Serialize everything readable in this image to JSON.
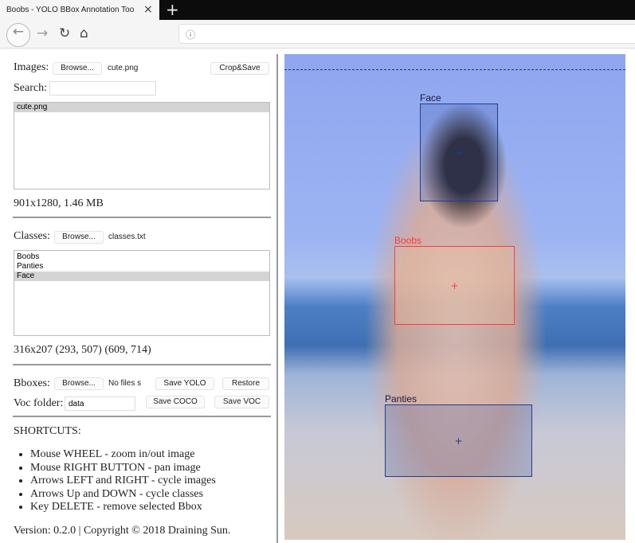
{
  "browser": {
    "tab_title": "Boobs - YOLO BBox Annotation Too",
    "close_icon": "×",
    "new_tab_icon": "+",
    "url": "ⓘ"
  },
  "images": {
    "label": "Images:",
    "browse": "Browse...",
    "file": "cute.png",
    "crop_save": "Crop&Save",
    "search_label": "Search:",
    "search_value": "",
    "list": [
      "cute.png"
    ],
    "info": "901x1280, 1.46 MB"
  },
  "classes": {
    "label": "Classes:",
    "browse": "Browse...",
    "file": "classes.txt",
    "list": [
      "Boobs",
      "Panties",
      "Face"
    ],
    "selected": "Face",
    "info": "316x207 (293, 507) (609, 714)"
  },
  "bboxes": {
    "label": "Bboxes:",
    "browse": "Browse...",
    "file": "No files s",
    "save_yolo": "Save YOLO",
    "restore": "Restore",
    "voc_label": "Voc folder:",
    "voc_value": "data",
    "save_coco": "Save COCO",
    "save_voc": "Save VOC"
  },
  "shortcuts": {
    "title": "SHORTCUTS:",
    "items": [
      "Mouse WHEEL - zoom in/out image",
      "Mouse RIGHT BUTTON - pan image",
      "Arrows LEFT and RIGHT - cycle images",
      "Arrows Up and DOWN - cycle classes",
      "Key DELETE - remove selected Bbox"
    ]
  },
  "footer": "Version: 0.2.0 | Copyright © 2018 Draining Sun.",
  "annotations": [
    {
      "label": "Face",
      "color": "#1f3f8f"
    },
    {
      "label": "Boobs",
      "color": "#ff3b3b"
    },
    {
      "label": "Panties",
      "color": "#1f3f8f"
    }
  ]
}
